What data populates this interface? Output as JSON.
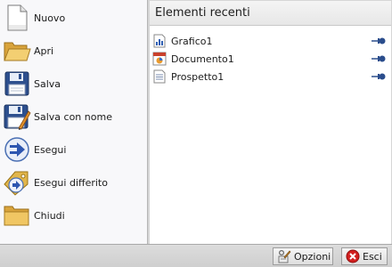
{
  "commands": [
    {
      "label": "Nuovo",
      "icon": "new-document-icon"
    },
    {
      "label": "Apri",
      "icon": "open-folder-icon"
    },
    {
      "label": "Salva",
      "icon": "save-disk-icon"
    },
    {
      "label": "Salva con nome",
      "icon": "save-as-icon"
    },
    {
      "label": "Esegui",
      "icon": "run-icon"
    },
    {
      "label": "Esegui differito",
      "icon": "deferred-run-icon"
    },
    {
      "label": "Chiudi",
      "icon": "close-folder-icon"
    }
  ],
  "recent": {
    "title": "Elementi recenti",
    "items": [
      {
        "label": "Grafico1",
        "icon": "chart-file-icon"
      },
      {
        "label": "Documento1",
        "icon": "document-file-icon"
      },
      {
        "label": "Prospetto1",
        "icon": "report-file-icon"
      }
    ]
  },
  "footer": {
    "options_label": "Opzioni",
    "exit_label": "Esci"
  },
  "colors": {
    "pane_bg": "#f8f8fa",
    "header_bg": "#ececec",
    "pin_blue": "#2b4d8c",
    "exit_red": "#d21f1f"
  }
}
